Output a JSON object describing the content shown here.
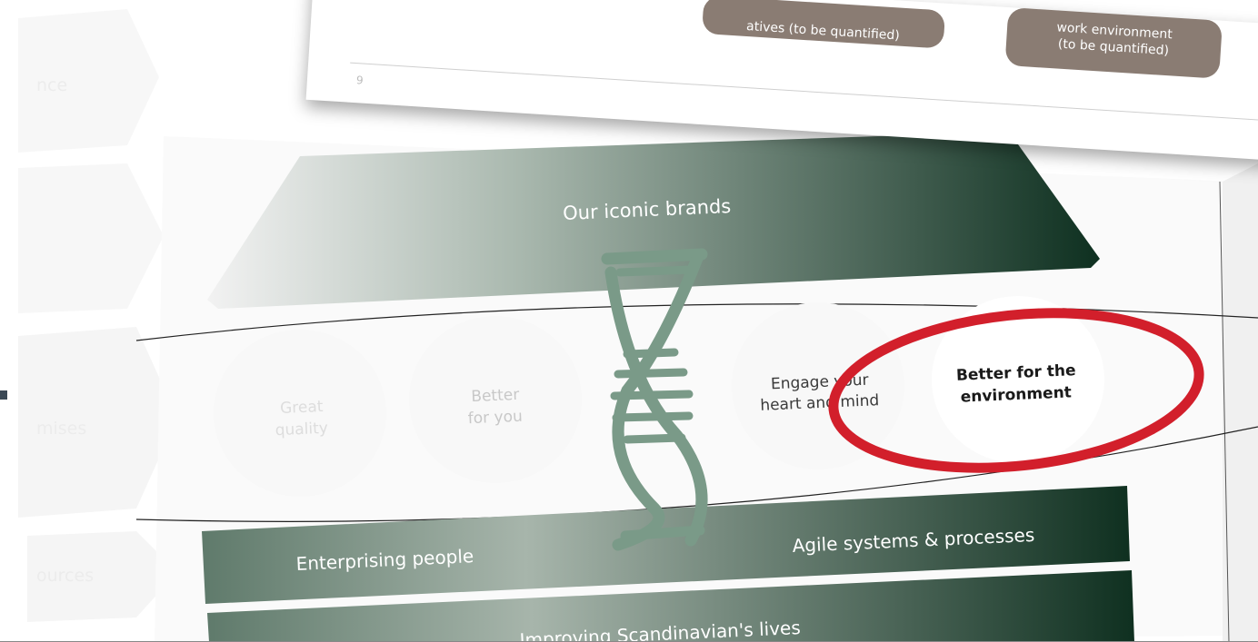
{
  "side_labels": [
    "nce",
    "",
    "mises",
    "ources"
  ],
  "top_slide": {
    "page_number": "9",
    "pill_left": "atives (to be quantified)",
    "pill_right_line1": "work environment",
    "pill_right_line2": "(to be quantified)"
  },
  "pyramid": {
    "title": "Our iconic brands"
  },
  "promises": {
    "circle1": [
      "Great",
      "quality"
    ],
    "circle2": [
      "Better",
      "for you"
    ],
    "circle3": [
      "Engage your",
      "heart and mind"
    ],
    "circle4": [
      "Better for the",
      "environment"
    ]
  },
  "bars": {
    "enterprising": "Enterprising people",
    "agile": "Agile systems & processes",
    "improving": "Improving Scandinavian's lives"
  },
  "colors": {
    "dark_green": "#0e3020",
    "light_green": "#a9b8ae",
    "dna": "#7a9a88",
    "circle_red": "#d21f2b",
    "pill": "#8a7c73"
  },
  "icons": {
    "dna": "dna-helix-icon",
    "highlight": "red-ellipse-annotation"
  }
}
